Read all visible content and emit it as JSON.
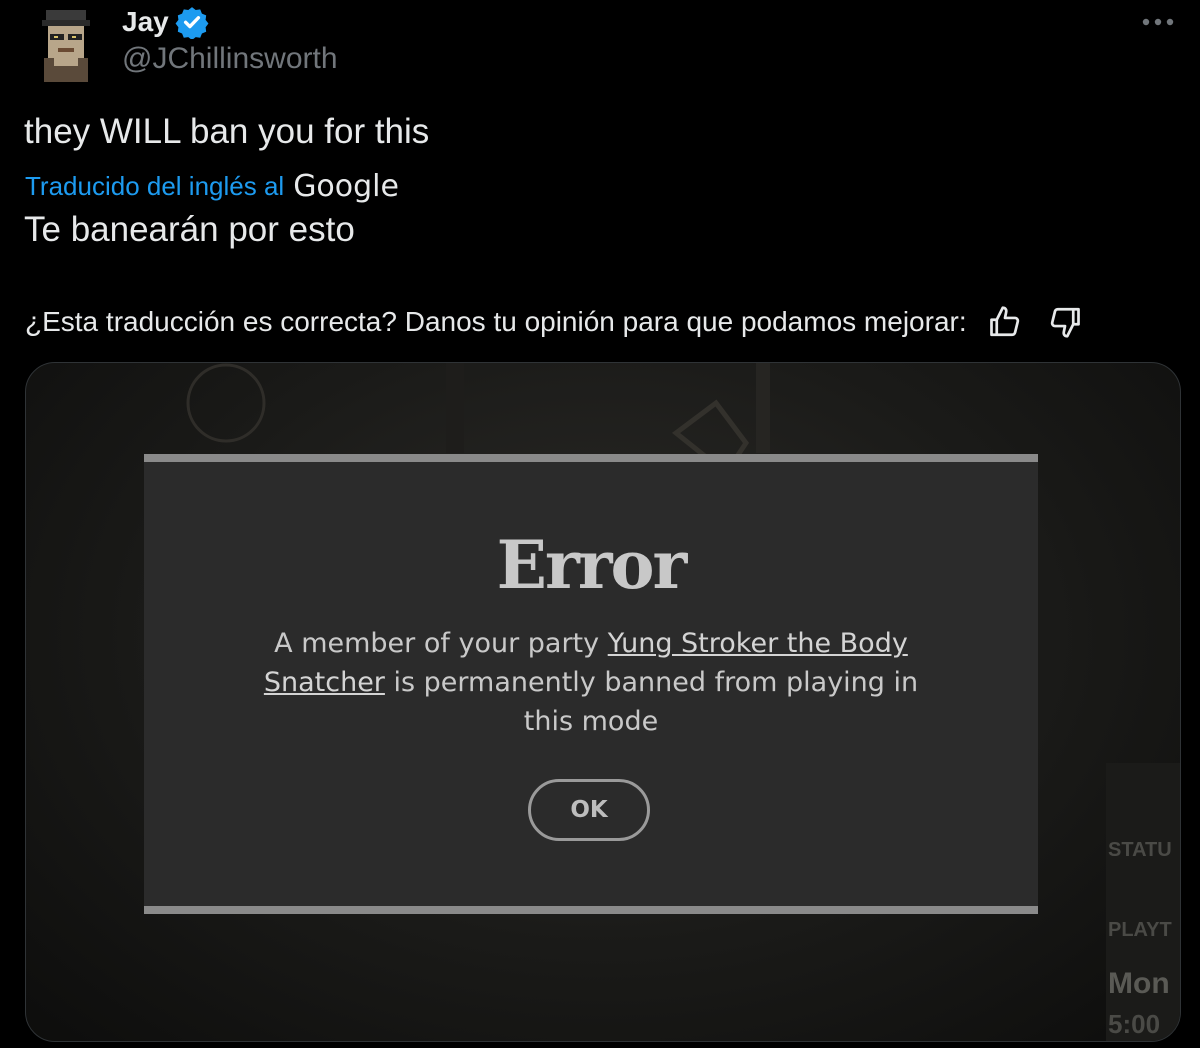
{
  "author": {
    "display_name": "Jay",
    "handle": "@JChillinsworth",
    "verified_icon": "verified-badge-icon",
    "avatar_icon": "pixel-avatar-icon"
  },
  "tweet": {
    "original_text": "they WILL ban you for this",
    "translated_label": "Traducido del inglés al",
    "translator_name": "Google",
    "translated_text": "Te banearán por esto",
    "feedback_question": "¿Esta traducción es correcta? Danos tu opinión para que podamos mejorar:",
    "more_icon": "more-options-icon",
    "thumbs_up_icon": "thumbs-up-icon",
    "thumbs_down_icon": "thumbs-down-icon"
  },
  "media": {
    "dialog": {
      "title": "Error",
      "message_before": "A member of your party ",
      "player_name": "Yung Stroker the Body Snatcher",
      "message_after": " is permanently banned from playing in this mode",
      "ok_label": "OK"
    },
    "side_panel": {
      "status_label": "STATU",
      "playtime_label": "PLAYT",
      "day_text": "Mon",
      "time_text": "5:00"
    }
  },
  "colors": {
    "background": "#000000",
    "link_blue": "#1d9bf0",
    "secondary_text": "#71767b",
    "dialog_bg": "#2b2b2b"
  }
}
